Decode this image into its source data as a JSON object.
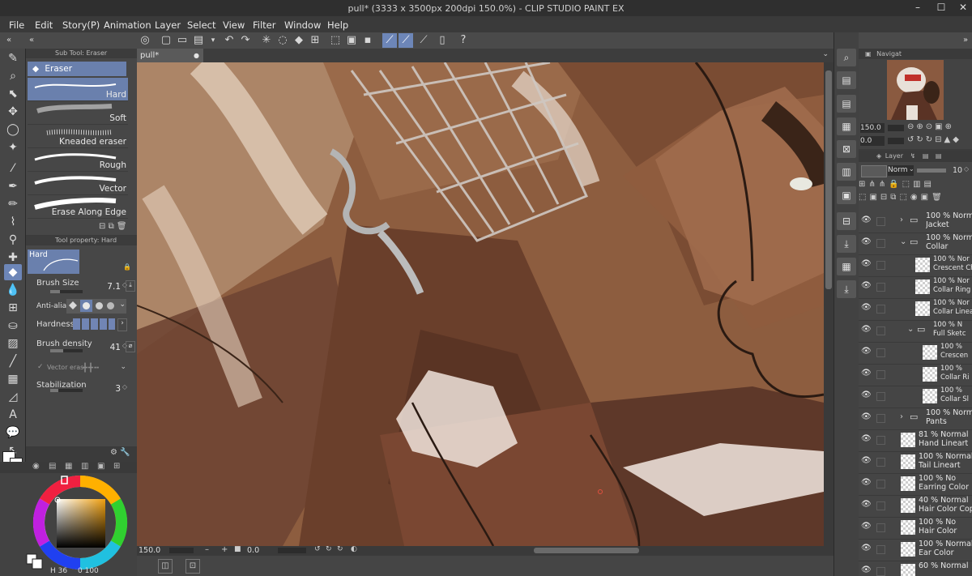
{
  "app": {
    "title": "pull* (3333 x 3500px 200dpi 150.0%)  - CLIP STUDIO PAINT EX"
  },
  "menu": [
    "File",
    "Edit",
    "Story(P)",
    "Animation",
    "Layer",
    "Select",
    "View",
    "Filter",
    "Window",
    "Help"
  ],
  "document_tab": "pull*",
  "subtool": {
    "header": "Sub Tool: Eraser",
    "group": "Eraser",
    "items": [
      {
        "label": "Hard",
        "selected": true
      },
      {
        "label": "Soft",
        "selected": false
      },
      {
        "label": "Kneaded eraser",
        "selected": false
      },
      {
        "label": "Rough",
        "selected": false
      },
      {
        "label": "Vector",
        "selected": false
      },
      {
        "label": "Erase Along Edge",
        "selected": false
      }
    ]
  },
  "tool_property": {
    "header": "Tool property: Hard",
    "preset": "Hard",
    "brush_size_label": "Brush Size",
    "brush_size": "7.1",
    "antialias_label": "Anti-alias",
    "hardness_label": "Hardness",
    "hardness_level": 4,
    "density_label": "Brush density",
    "density": "41",
    "vector_eraser_label": "Vector eras",
    "stabilization_label": "Stabilization",
    "stabilization": "3"
  },
  "color": {
    "hue_readout": "36",
    "sv_readout_a": "0",
    "sv_readout_b": "100",
    "main_color": "#ffffff",
    "sub_color": "#ffffff"
  },
  "canvas_status": {
    "zoom": "150.0",
    "rotation": "0.0"
  },
  "navigator": {
    "header": "Navigat",
    "zoom": "150.0",
    "rotation": "0.0"
  },
  "layer_panel": {
    "header": "Layer",
    "blend_mode": "Norm",
    "opacity": "10",
    "layers": [
      {
        "kind": "folder",
        "expanded": false,
        "indent": 1,
        "line1": "100 % Norm",
        "line2": "Jacket",
        "small": false
      },
      {
        "kind": "folder",
        "expanded": true,
        "indent": 1,
        "line1": "100 % Norm",
        "line2": "Collar",
        "small": false
      },
      {
        "kind": "layer",
        "indent": 2,
        "line1": "100 % Nor",
        "line2": "Crescent Ch",
        "small": true
      },
      {
        "kind": "layer",
        "indent": 2,
        "line1": "100 % Nor",
        "line2": "Collar Ring L",
        "small": true
      },
      {
        "kind": "layer",
        "indent": 2,
        "line1": "100 % Nor",
        "line2": "Collar Linea",
        "small": true
      },
      {
        "kind": "folder",
        "expanded": true,
        "indent": 2,
        "line1": "100 % N",
        "line2": "Full Sketc",
        "small": true
      },
      {
        "kind": "layer",
        "indent": 3,
        "line1": "100 %",
        "line2": "Crescen",
        "small": true
      },
      {
        "kind": "layer",
        "indent": 3,
        "line1": "100 %",
        "line2": "Collar Ri",
        "small": true
      },
      {
        "kind": "layer",
        "indent": 3,
        "line1": "100 %",
        "line2": "Collar Sl",
        "small": true
      },
      {
        "kind": "folder",
        "expanded": false,
        "indent": 1,
        "line1": "100 % Norm",
        "line2": "Pants",
        "small": false
      },
      {
        "kind": "layer",
        "indent": 0,
        "line1": "81 % Normal",
        "line2": "Hand Lineart",
        "small": false
      },
      {
        "kind": "layer",
        "indent": 0,
        "line1": "100 % Normal",
        "line2": "Tail Lineart",
        "small": false
      },
      {
        "kind": "layer",
        "indent": 0,
        "line1": "100 % No",
        "line2": "Earring Color",
        "small": false
      },
      {
        "kind": "layer",
        "indent": 0,
        "line1": "40 % Normal",
        "line2": "Hair Color Copy",
        "small": false
      },
      {
        "kind": "layer",
        "indent": 0,
        "line1": "100 % No",
        "line2": "Hair Color",
        "small": false
      },
      {
        "kind": "layer",
        "indent": 0,
        "line1": "100 % Normal",
        "line2": "Ear Color",
        "small": false
      },
      {
        "kind": "layer",
        "indent": 0,
        "line1": "60 % Normal",
        "line2": "",
        "small": false
      }
    ]
  },
  "colors": {
    "accent": "#6d86b8",
    "panel": "#474747",
    "canvas_base": "#8a5a3c"
  }
}
